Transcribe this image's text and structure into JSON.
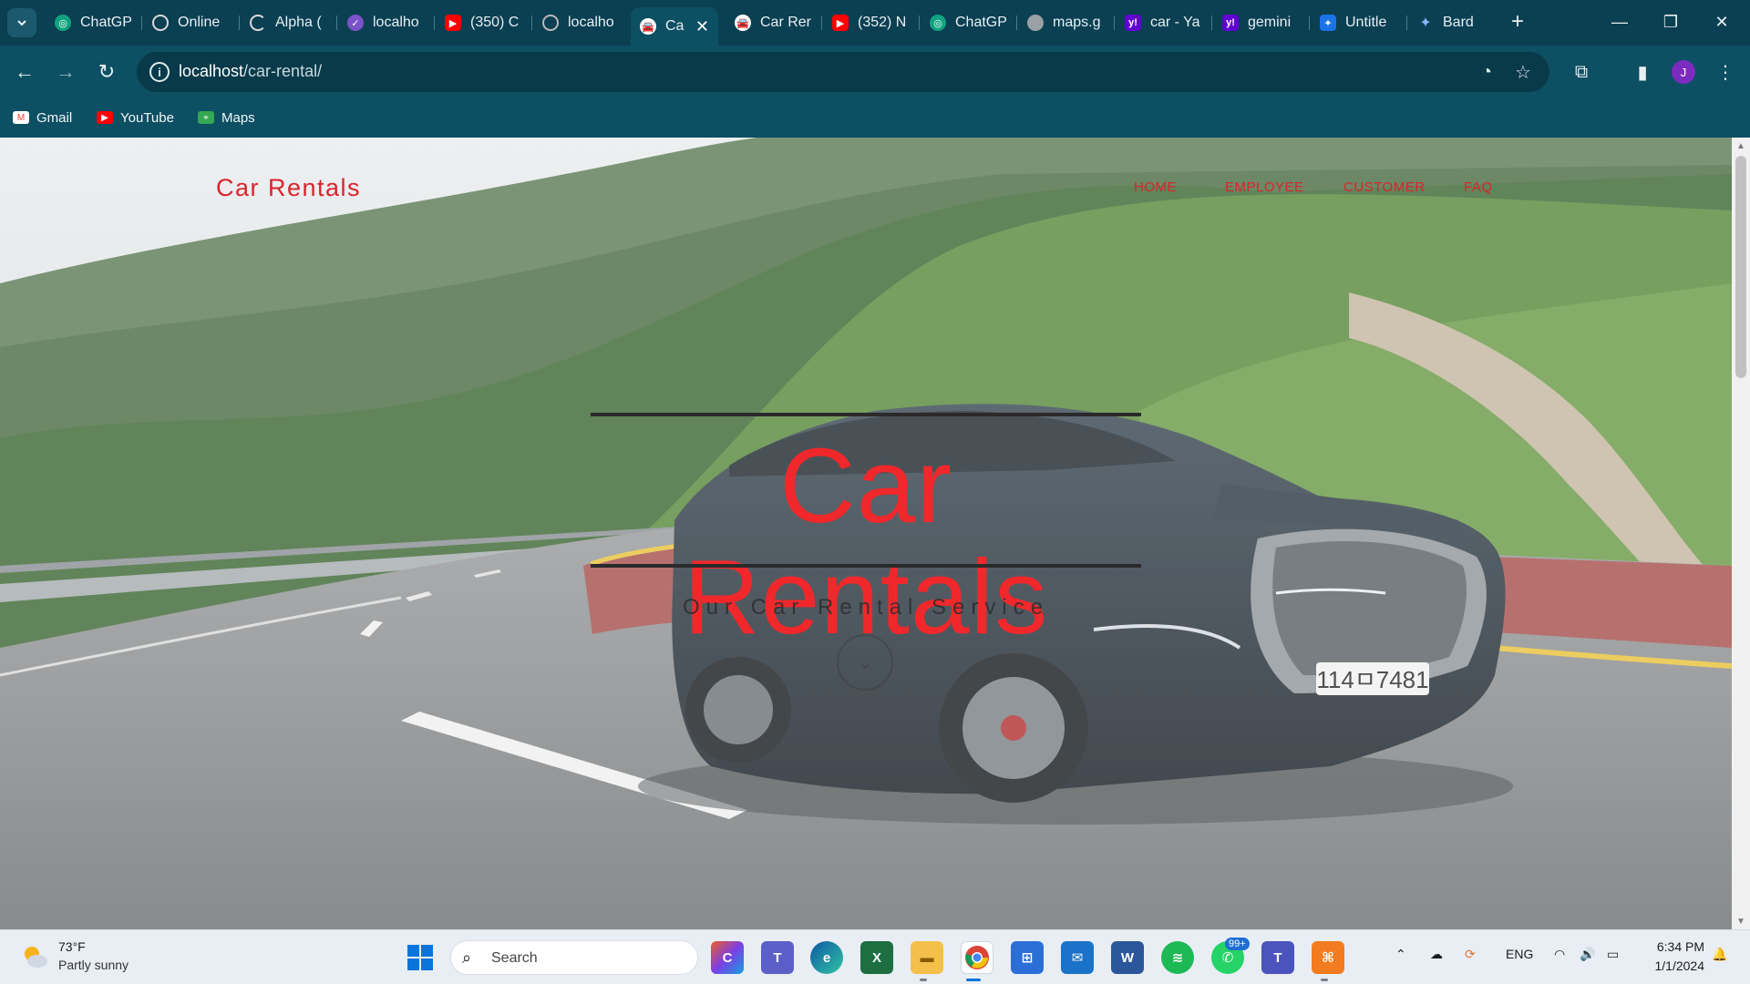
{
  "browser": {
    "tabs": [
      {
        "title": "ChatGP",
        "icon": "chatgpt-icon",
        "color": "#10a37f"
      },
      {
        "title": "Online",
        "icon": "openai-icon",
        "color": "#d9d9d9"
      },
      {
        "title": "Alpha (",
        "icon": "loading-icon",
        "color": "#d9d9d9"
      },
      {
        "title": "localho",
        "icon": "localhost-icon",
        "color": "#7b52c8"
      },
      {
        "title": "(350) C",
        "icon": "youtube-icon",
        "color": "#ff0000"
      },
      {
        "title": "localho",
        "icon": "localhost-icon",
        "color": "#b8b8b8"
      },
      {
        "title": "Ca",
        "icon": "car-icon",
        "color": "#1b1b1b"
      },
      {
        "title": "Car Rer",
        "icon": "car-icon",
        "color": "#1b1b1b"
      },
      {
        "title": "(352) N",
        "icon": "youtube-icon",
        "color": "#ff0000"
      },
      {
        "title": "ChatGP",
        "icon": "chatgpt-icon",
        "color": "#10a37f"
      },
      {
        "title": "maps.g",
        "icon": "globe-icon",
        "color": "#9aa0a6"
      },
      {
        "title": "car - Ya",
        "icon": "yahoo-icon",
        "color": "#6001d2"
      },
      {
        "title": "gemini",
        "icon": "yahoo-icon",
        "color": "#6001d2"
      },
      {
        "title": "Untitle",
        "icon": "app-icon",
        "color": "#1a73e8"
      },
      {
        "title": "Bard",
        "icon": "bard-icon",
        "color": "#4285f4"
      }
    ],
    "url_host": "localhost",
    "url_path": "/car-rental/",
    "bookmarks": [
      {
        "label": "Gmail",
        "icon": "gmail-icon",
        "color": "#ea4335"
      },
      {
        "label": "YouTube",
        "icon": "youtube-icon",
        "color": "#ff0000"
      },
      {
        "label": "Maps",
        "icon": "maps-icon",
        "color": "#34a853"
      }
    ],
    "profile_initial": "J"
  },
  "site": {
    "brand": "Car Rentals",
    "nav": [
      "HOME",
      "EMPLOYEE",
      "CUSTOMER",
      "FAQ"
    ],
    "hero_title": "Car Rentals",
    "hero_subtitle": "Our Car Rental Service",
    "accent_color": "#d9242c"
  },
  "taskbar": {
    "weather_temp": "73°F",
    "weather_desc": "Partly sunny",
    "search_placeholder": "Search",
    "whatsapp_badge": "99+",
    "language": "ENG",
    "time": "6:34 PM",
    "date": "1/1/2024"
  }
}
